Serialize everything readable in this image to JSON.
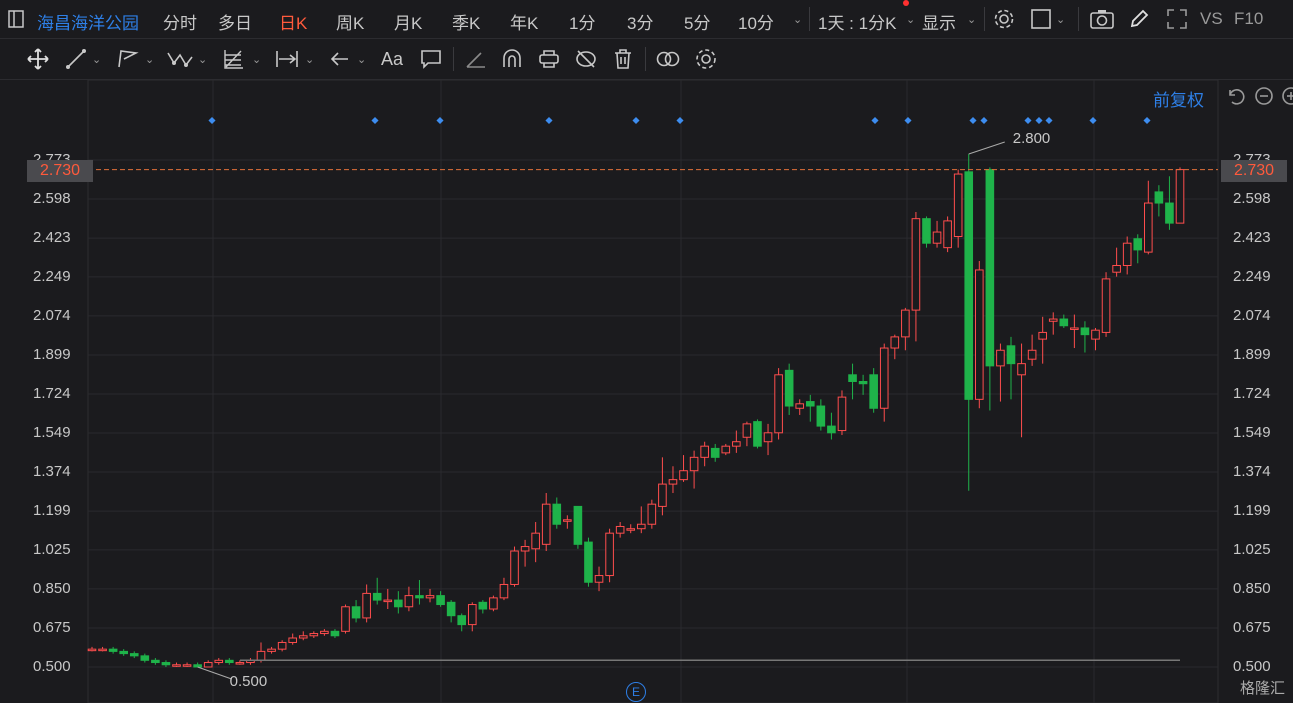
{
  "top_bar": {
    "stock_name": "海昌海洋公园",
    "periods": [
      "分时",
      "多日",
      "日K",
      "周K",
      "月K",
      "季K",
      "年K",
      "1分",
      "3分",
      "5分",
      "10分"
    ],
    "active_period": "日K",
    "interval_select": "1天 : 1分K",
    "display_label": "显示",
    "vs_label": "VS",
    "f10_label": "F10"
  },
  "toolbar": {
    "text_tool_label": "Aa",
    "icons": [
      "move-icon",
      "line-tool-icon",
      "polyline-tool-icon",
      "wave-tool-icon",
      "fib-tool-icon",
      "range-tool-icon",
      "arrow-tool-icon",
      "text-tool-icon",
      "comment-tool-icon",
      "angle-tool-icon",
      "arc-tool-icon",
      "magnet-icon",
      "hide-icon",
      "delete-icon",
      "compare-icon",
      "settings-icon"
    ]
  },
  "adjust_label": "前复权",
  "colors": {
    "up": "#ff4d4d",
    "down": "#1fb34a",
    "accent": "#2e7fe6",
    "price_line": "#e0703a"
  },
  "chart_data": {
    "type": "candlestick",
    "title": "",
    "xlabel": "",
    "ylabel": "",
    "ylim": [
      0.45,
      2.78
    ],
    "yticks": [
      "2.773",
      "2.598",
      "2.423",
      "2.249",
      "2.074",
      "1.899",
      "1.724",
      "1.549",
      "1.374",
      "1.199",
      "1.025",
      "0.850",
      "0.675",
      "0.500"
    ],
    "current_price": "2.730",
    "max_label": "2.800",
    "min_label": "0.500",
    "event_marker": "E",
    "candles": [
      [
        0.58,
        0.58,
        0.59,
        0.57
      ],
      [
        0.58,
        0.58,
        0.59,
        0.57
      ],
      [
        0.58,
        0.57,
        0.59,
        0.56
      ],
      [
        0.57,
        0.56,
        0.58,
        0.55
      ],
      [
        0.56,
        0.55,
        0.57,
        0.54
      ],
      [
        0.55,
        0.53,
        0.56,
        0.52
      ],
      [
        0.53,
        0.52,
        0.54,
        0.51
      ],
      [
        0.52,
        0.51,
        0.53,
        0.5
      ],
      [
        0.51,
        0.51,
        0.52,
        0.5
      ],
      [
        0.51,
        0.51,
        0.52,
        0.5
      ],
      [
        0.51,
        0.5,
        0.52,
        0.5
      ],
      [
        0.5,
        0.52,
        0.53,
        0.5
      ],
      [
        0.52,
        0.53,
        0.54,
        0.51
      ],
      [
        0.53,
        0.52,
        0.54,
        0.51
      ],
      [
        0.52,
        0.52,
        0.53,
        0.51
      ],
      [
        0.52,
        0.53,
        0.54,
        0.51
      ],
      [
        0.53,
        0.57,
        0.61,
        0.52
      ],
      [
        0.57,
        0.58,
        0.59,
        0.56
      ],
      [
        0.58,
        0.61,
        0.62,
        0.57
      ],
      [
        0.61,
        0.63,
        0.65,
        0.6
      ],
      [
        0.63,
        0.64,
        0.66,
        0.62
      ],
      [
        0.64,
        0.65,
        0.66,
        0.63
      ],
      [
        0.65,
        0.66,
        0.67,
        0.64
      ],
      [
        0.66,
        0.64,
        0.67,
        0.63
      ],
      [
        0.66,
        0.77,
        0.78,
        0.65
      ],
      [
        0.77,
        0.72,
        0.8,
        0.7
      ],
      [
        0.72,
        0.83,
        0.87,
        0.7
      ],
      [
        0.83,
        0.8,
        0.9,
        0.78
      ],
      [
        0.8,
        0.8,
        0.85,
        0.76
      ],
      [
        0.8,
        0.77,
        0.84,
        0.74
      ],
      [
        0.77,
        0.82,
        0.86,
        0.75
      ],
      [
        0.82,
        0.81,
        0.89,
        0.78
      ],
      [
        0.81,
        0.82,
        0.85,
        0.79
      ],
      [
        0.82,
        0.78,
        0.84,
        0.77
      ],
      [
        0.79,
        0.73,
        0.8,
        0.7
      ],
      [
        0.73,
        0.69,
        0.74,
        0.66
      ],
      [
        0.69,
        0.78,
        0.79,
        0.66
      ],
      [
        0.79,
        0.76,
        0.8,
        0.74
      ],
      [
        0.76,
        0.81,
        0.82,
        0.75
      ],
      [
        0.81,
        0.87,
        0.9,
        0.8
      ],
      [
        0.87,
        1.02,
        1.04,
        0.86
      ],
      [
        1.02,
        1.04,
        1.07,
        0.95
      ],
      [
        1.03,
        1.1,
        1.15,
        0.97
      ],
      [
        1.05,
        1.23,
        1.28,
        1.02
      ],
      [
        1.23,
        1.14,
        1.26,
        1.12
      ],
      [
        1.16,
        1.16,
        1.18,
        1.12
      ],
      [
        1.22,
        1.05,
        1.22,
        1.03
      ],
      [
        1.06,
        0.88,
        1.08,
        0.86
      ],
      [
        0.88,
        0.91,
        0.95,
        0.84
      ],
      [
        0.91,
        1.1,
        1.12,
        0.88
      ],
      [
        1.1,
        1.13,
        1.15,
        1.08
      ],
      [
        1.12,
        1.12,
        1.14,
        1.1
      ],
      [
        1.12,
        1.14,
        1.22,
        1.1
      ],
      [
        1.14,
        1.23,
        1.25,
        1.12
      ],
      [
        1.22,
        1.32,
        1.44,
        1.18
      ],
      [
        1.32,
        1.34,
        1.4,
        1.28
      ],
      [
        1.34,
        1.38,
        1.45,
        1.33
      ],
      [
        1.38,
        1.44,
        1.47,
        1.3
      ],
      [
        1.44,
        1.49,
        1.51,
        1.4
      ],
      [
        1.48,
        1.44,
        1.5,
        1.42
      ],
      [
        1.46,
        1.49,
        1.5,
        1.45
      ],
      [
        1.49,
        1.51,
        1.56,
        1.46
      ],
      [
        1.53,
        1.59,
        1.6,
        1.49
      ],
      [
        1.6,
        1.49,
        1.61,
        1.48
      ],
      [
        1.51,
        1.55,
        1.59,
        1.45
      ],
      [
        1.55,
        1.81,
        1.84,
        1.52
      ],
      [
        1.83,
        1.67,
        1.86,
        1.63
      ],
      [
        1.66,
        1.68,
        1.7,
        1.63
      ],
      [
        1.69,
        1.67,
        1.72,
        1.6
      ],
      [
        1.67,
        1.58,
        1.7,
        1.56
      ],
      [
        1.58,
        1.55,
        1.64,
        1.52
      ],
      [
        1.56,
        1.71,
        1.74,
        1.54
      ],
      [
        1.81,
        1.78,
        1.86,
        1.7
      ],
      [
        1.78,
        1.77,
        1.81,
        1.72
      ],
      [
        1.81,
        1.66,
        1.84,
        1.64
      ],
      [
        1.66,
        1.93,
        1.95,
        1.6
      ],
      [
        1.93,
        1.98,
        1.99,
        1.88
      ],
      [
        1.98,
        2.1,
        2.11,
        1.92
      ],
      [
        2.1,
        2.51,
        2.54,
        1.96
      ],
      [
        2.51,
        2.4,
        2.52,
        2.38
      ],
      [
        2.4,
        2.45,
        2.5,
        2.38
      ],
      [
        2.38,
        2.5,
        2.52,
        2.36
      ],
      [
        2.43,
        2.71,
        2.73,
        2.38
      ],
      [
        2.72,
        1.7,
        2.8,
        1.29
      ],
      [
        1.7,
        2.28,
        2.32,
        1.66
      ],
      [
        2.73,
        1.85,
        2.74,
        1.65
      ],
      [
        1.85,
        1.92,
        1.95,
        1.69
      ],
      [
        1.94,
        1.86,
        1.98,
        1.7
      ],
      [
        1.81,
        1.86,
        1.95,
        1.53
      ],
      [
        1.88,
        1.92,
        1.99,
        1.85
      ],
      [
        1.97,
        2.0,
        2.07,
        1.86
      ],
      [
        2.05,
        2.06,
        2.09,
        1.99
      ],
      [
        2.06,
        2.03,
        2.08,
        2.02
      ],
      [
        2.02,
        2.02,
        2.08,
        1.93
      ],
      [
        2.02,
        1.99,
        2.05,
        1.91
      ],
      [
        1.97,
        2.01,
        2.02,
        1.92
      ],
      [
        2.0,
        2.24,
        2.27,
        1.98
      ],
      [
        2.27,
        2.3,
        2.38,
        2.25
      ],
      [
        2.3,
        2.4,
        2.43,
        2.26
      ],
      [
        2.42,
        2.37,
        2.44,
        2.31
      ],
      [
        2.36,
        2.58,
        2.68,
        2.35
      ],
      [
        2.63,
        2.58,
        2.66,
        2.52
      ],
      [
        2.58,
        2.49,
        2.7,
        2.46
      ],
      [
        2.49,
        2.73,
        2.74,
        2.49
      ]
    ]
  }
}
